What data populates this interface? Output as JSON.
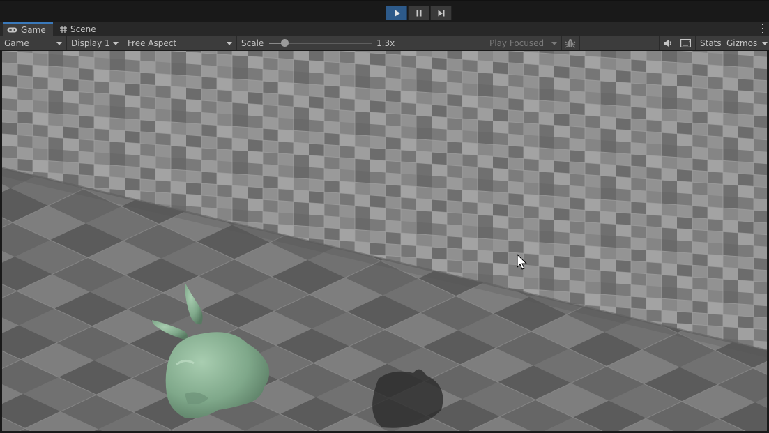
{
  "toolbar": {
    "play_icon": "play-icon",
    "pause_icon": "pause-icon",
    "step_icon": "step-icon",
    "accent": "#2d5a8a"
  },
  "tabs": [
    {
      "label": "Game",
      "icon": "gamepad-icon",
      "active": true
    },
    {
      "label": "Scene",
      "icon": "grid-icon",
      "active": false
    }
  ],
  "game_toolbar": {
    "view_mode": "Game",
    "display": "Display 1",
    "aspect": "Free Aspect",
    "scale_label": "Scale",
    "scale_value": "1.3x",
    "scale_fraction": 0.15,
    "play_mode": "Play Focused",
    "stats_label": "Stats",
    "gizmos_label": "Gizmos"
  },
  "scene": {
    "object": "green-bunny",
    "object_color": "#7fa88a",
    "floor_color": "#6e6e6e",
    "wall_color": "#8a8a8a"
  }
}
